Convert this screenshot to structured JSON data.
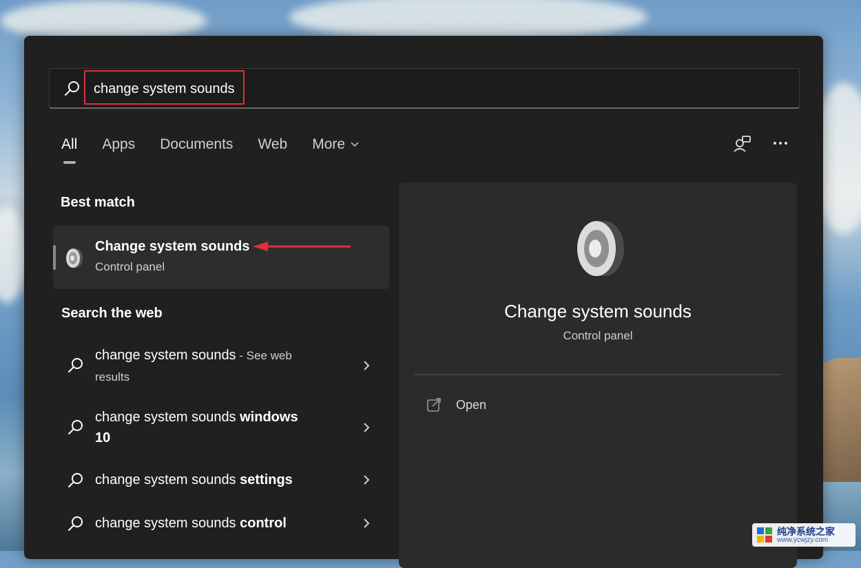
{
  "search": {
    "query": "change system sounds"
  },
  "tabs": [
    {
      "label": "All"
    },
    {
      "label": "Apps"
    },
    {
      "label": "Documents"
    },
    {
      "label": "Web"
    },
    {
      "label": "More"
    }
  ],
  "sections": {
    "best_match": "Best match",
    "search_web": "Search the web"
  },
  "best_match": {
    "title": "Change system sounds",
    "subtitle": "Control panel"
  },
  "web_results": [
    {
      "prefix": "change system sounds",
      "bold": "",
      "suffix": " - See web results"
    },
    {
      "prefix": "change system sounds ",
      "bold": "windows 10",
      "suffix": ""
    },
    {
      "prefix": "change system sounds ",
      "bold": "settings",
      "suffix": ""
    },
    {
      "prefix": "change system sounds ",
      "bold": "control",
      "suffix": ""
    }
  ],
  "detail": {
    "title": "Change system sounds",
    "subtitle": "Control panel",
    "open_label": "Open"
  },
  "watermark": {
    "title": "纯净系统之家",
    "url": "www.ycwjzy.com"
  },
  "colors": {
    "panel_bg": "#202020",
    "highlight_box": "#e0303a",
    "arrow": "#e0303a"
  }
}
